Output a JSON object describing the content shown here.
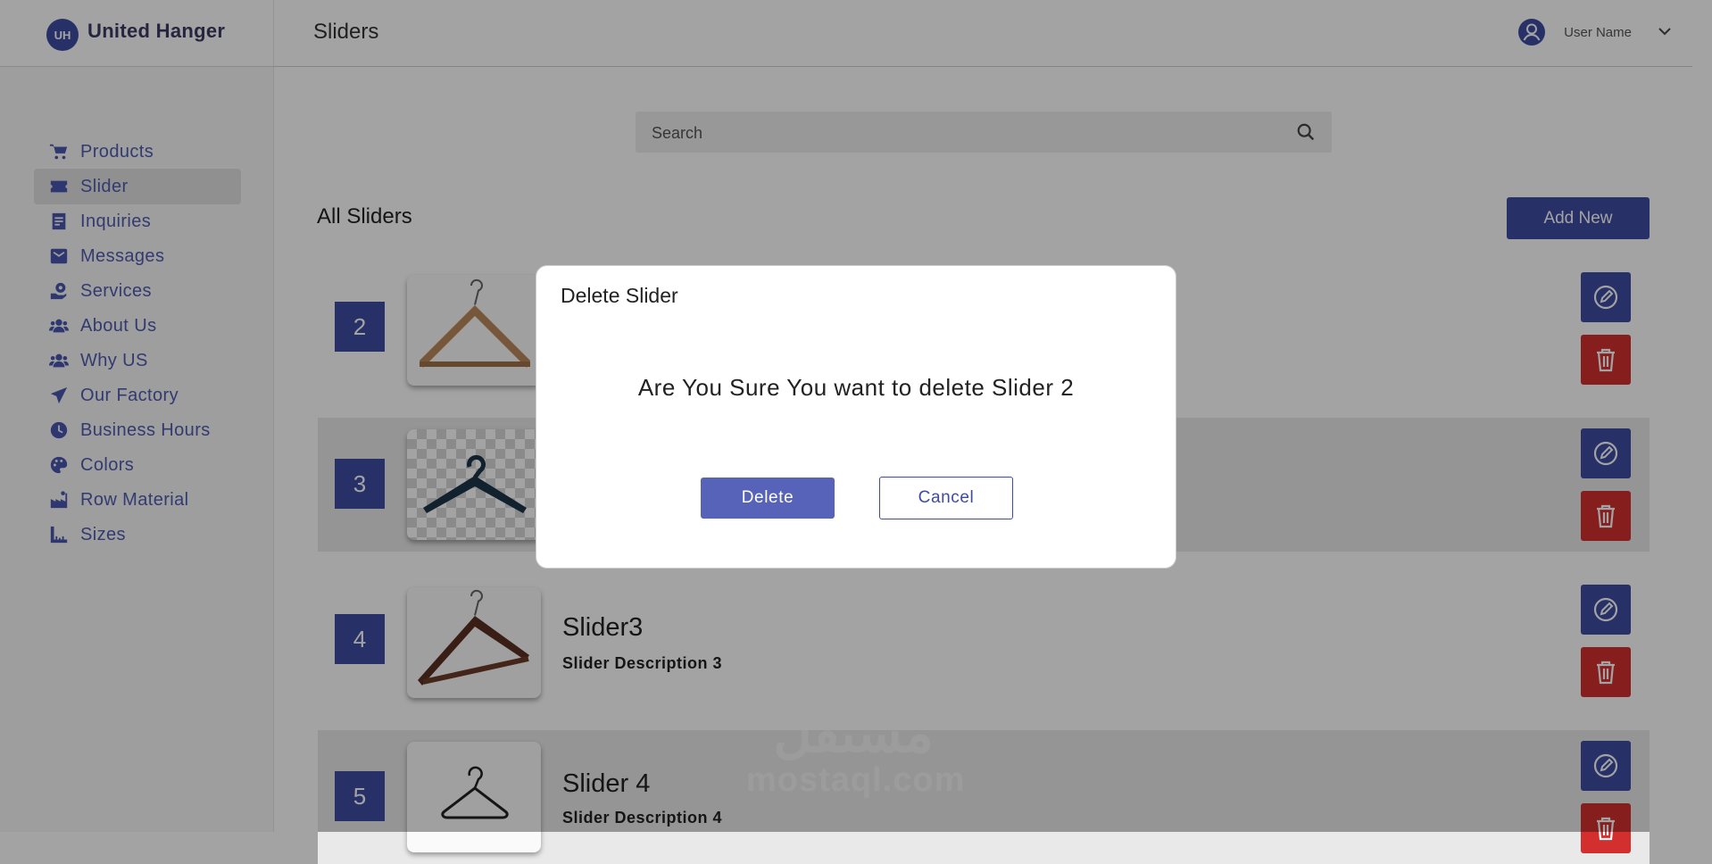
{
  "brand": {
    "initials": "UH",
    "name": "United Hanger"
  },
  "header": {
    "title": "Sliders",
    "user_name": "User Name"
  },
  "sidebar": {
    "items": [
      {
        "label": "Products",
        "icon": "cart-icon"
      },
      {
        "label": "Slider",
        "icon": "ticket-icon",
        "active": true
      },
      {
        "label": "Inquiries",
        "icon": "list-icon"
      },
      {
        "label": "Messages",
        "icon": "envelope-icon"
      },
      {
        "label": "Services",
        "icon": "hand-gear-icon"
      },
      {
        "label": "About Us",
        "icon": "users-icon"
      },
      {
        "label": "Why US",
        "icon": "users-icon"
      },
      {
        "label": "Our Factory",
        "icon": "paper-plane-icon"
      },
      {
        "label": "Business Hours",
        "icon": "clock-icon"
      },
      {
        "label": "Colors",
        "icon": "palette-icon"
      },
      {
        "label": "Row Material",
        "icon": "industry-icon"
      },
      {
        "label": "Sizes",
        "icon": "ruler-icon"
      }
    ]
  },
  "search": {
    "placeholder": "Search"
  },
  "main": {
    "section_title": "All Sliders",
    "add_new_label": "Add New",
    "rows": [
      {
        "number": "2",
        "title": "",
        "description": ""
      },
      {
        "number": "3",
        "title": "",
        "description": ""
      },
      {
        "number": "4",
        "title": "Slider3",
        "description": "Slider Description 3"
      },
      {
        "number": "5",
        "title": "Slider 4",
        "description": "Slider Description 4"
      }
    ]
  },
  "watermark": {
    "arabic": "مستقل",
    "latin": "mostaql.com"
  },
  "modal": {
    "title": "Delete Slider",
    "message": "Are You Sure You want to delete Slider 2",
    "delete_label": "Delete",
    "cancel_label": "Cancel"
  },
  "colors": {
    "primary": "#3f4ba3",
    "danger": "#d32f2f",
    "overlay": "rgba(0,0,0,0.36)"
  }
}
